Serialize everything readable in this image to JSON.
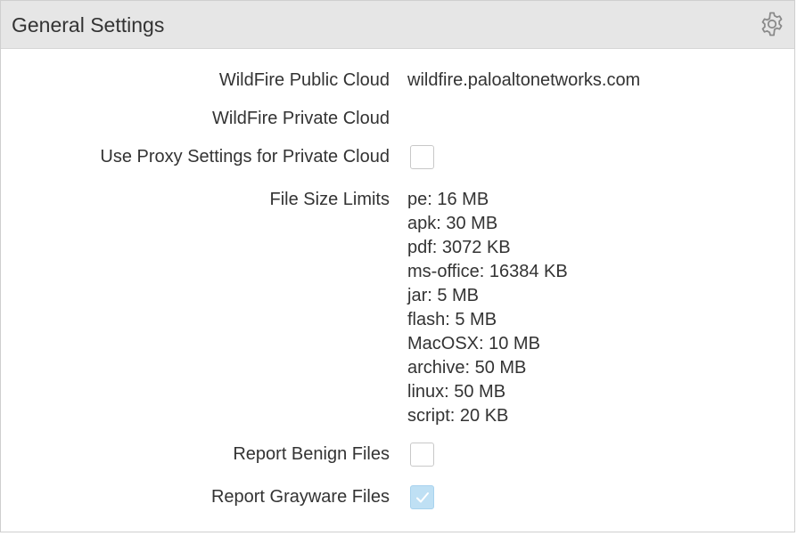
{
  "panel": {
    "title": "General Settings",
    "icon": "gear-icon"
  },
  "settings": {
    "public_cloud": {
      "label": "WildFire Public Cloud",
      "value": "wildfire.paloaltonetworks.com"
    },
    "private_cloud": {
      "label": "WildFire Private Cloud",
      "value": ""
    },
    "use_proxy": {
      "label": "Use Proxy Settings for Private Cloud",
      "checked": false
    },
    "file_size_limits": {
      "label": "File Size Limits",
      "items": [
        "pe: 16 MB",
        "apk: 30 MB",
        "pdf: 3072 KB",
        "ms-office: 16384 KB",
        "jar: 5 MB",
        "flash: 5 MB",
        "MacOSX: 10 MB",
        "archive: 50 MB",
        "linux: 50 MB",
        "script: 20 KB"
      ]
    },
    "report_benign": {
      "label": "Report Benign Files",
      "checked": false
    },
    "report_grayware": {
      "label": "Report Grayware Files",
      "checked": true
    }
  },
  "colors": {
    "header_bg": "#e6e6e6",
    "text": "#333333",
    "checkbox_checked_bg": "#bfe0f4",
    "checkmark": "#ffffff"
  }
}
